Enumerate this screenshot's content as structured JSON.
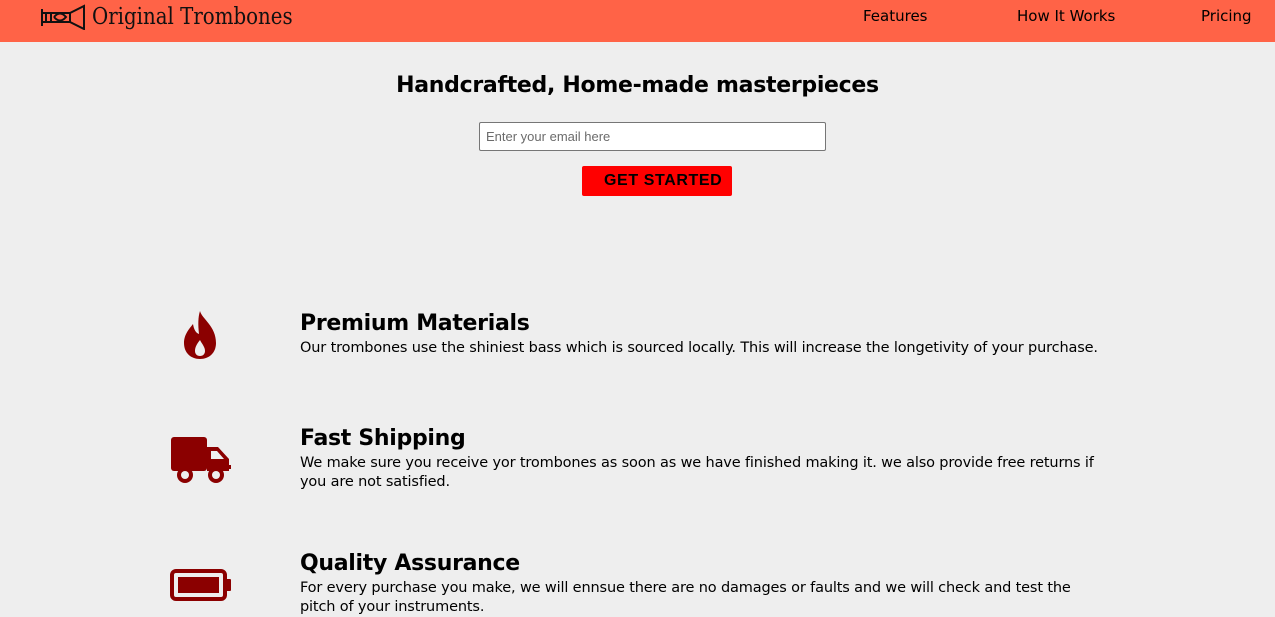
{
  "header": {
    "brand": "Original Trombones",
    "nav": [
      {
        "label": "Features"
      },
      {
        "label": "How It Works"
      },
      {
        "label": "Pricing"
      }
    ]
  },
  "hero": {
    "title": "Handcrafted, Home-made masterpieces",
    "email_placeholder": "Enter your email here",
    "button_label": "GET STARTED"
  },
  "features": [
    {
      "icon": "fire-icon",
      "title": "Premium Materials",
      "description": "Our trombones use the shiniest bass which is sourced locally. This will increase the longetivity of your purchase."
    },
    {
      "icon": "truck-icon",
      "title": "Fast Shipping",
      "description": "We make sure you receive yor trombones as soon as we have finished making it. we also provide free returns if you are not satisfied."
    },
    {
      "icon": "battery-icon",
      "title": "Quality Assurance",
      "description": "For every purchase you make, we will ennsue there are no damages or faults and we will check and test the pitch of your instruments."
    }
  ],
  "colors": {
    "header_bg": "#ff6347",
    "page_bg": "#eeeeee",
    "button_bg": "#ff0000",
    "icon_color": "#8b0000"
  }
}
